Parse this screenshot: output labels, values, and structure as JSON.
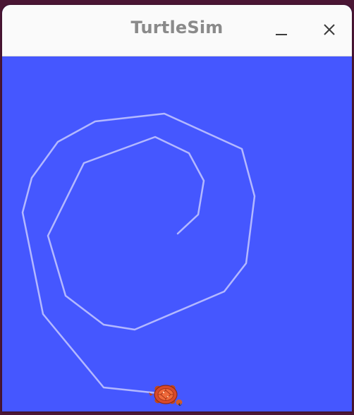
{
  "window": {
    "title": "TurtleSim"
  },
  "controls": {
    "minimize_icon": "minimize-icon",
    "close_icon": "close-icon"
  },
  "canvas": {
    "background_color": "#4557ff",
    "pen_color": "#b3b8ff",
    "turtle_icon": "turtle-icon"
  }
}
